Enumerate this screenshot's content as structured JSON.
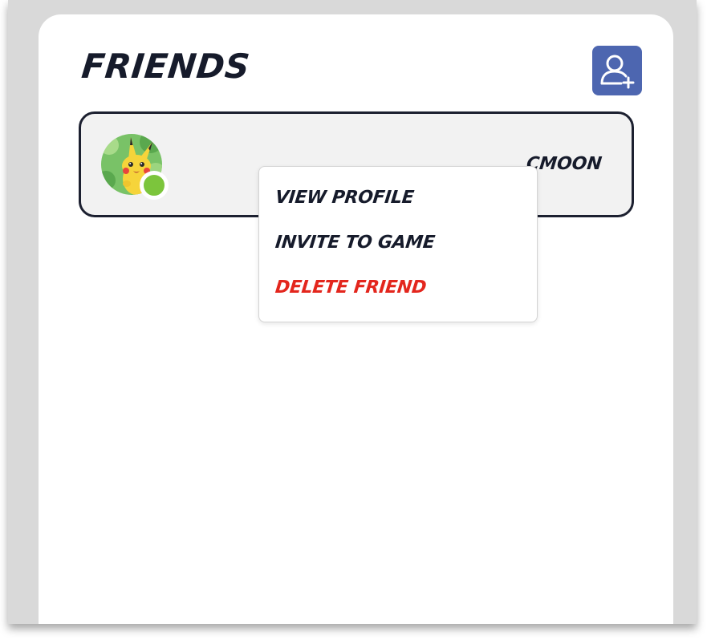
{
  "header": {
    "title": "FRIENDS",
    "add_friend_icon": "add-user-icon"
  },
  "friends": [
    {
      "username": "CMOON",
      "avatar": "pikachu-avatar",
      "status": "online",
      "status_color": "#7cc53c"
    }
  ],
  "context_menu": {
    "items": [
      {
        "label": "VIEW PROFILE",
        "color": "#161b2b"
      },
      {
        "label": "INVITE TO GAME",
        "color": "#161b2b"
      },
      {
        "label": "DELETE FRIEND",
        "color": "#e3261d"
      }
    ]
  },
  "colors": {
    "accent": "#4d66b0",
    "text": "#161b2b",
    "danger": "#e3261d",
    "card_bg": "#f2f2f2",
    "card_border": "#1c2030"
  }
}
